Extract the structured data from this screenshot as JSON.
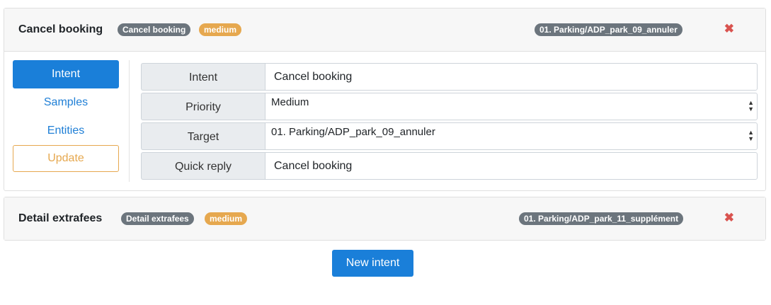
{
  "intents": [
    {
      "title": "Cancel booking",
      "name_badge": "Cancel booking",
      "priority_badge": "medium",
      "target_badge": "01. Parking/ADP_park_09_annuler",
      "close": "✖"
    },
    {
      "title": "Detail extrafees",
      "name_badge": "Detail extrafees",
      "priority_badge": "medium",
      "target_badge": "01. Parking/ADP_park_11_supplément",
      "close": "✖"
    }
  ],
  "nav": {
    "intent": "Intent",
    "samples": "Samples",
    "entities": "Entities",
    "update": "Update"
  },
  "form": {
    "intent_label": "Intent",
    "intent_value": "Cancel booking",
    "priority_label": "Priority",
    "priority_value": "Medium",
    "target_label": "Target",
    "target_value": "01. Parking/ADP_park_09_annuler",
    "quick_reply_label": "Quick reply",
    "quick_reply_value": "Cancel booking"
  },
  "new_intent_label": "New intent",
  "icons": {
    "close": "close-icon",
    "select": "updown-arrows-icon"
  },
  "colors": {
    "primary": "#1a7fd9",
    "warning": "#e6a84f",
    "danger": "#d9534f",
    "badge_gray": "#6c757d"
  }
}
